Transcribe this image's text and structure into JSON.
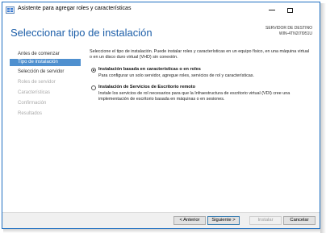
{
  "window": {
    "title": "Asistente para agregar roles y características"
  },
  "header": {
    "page_title": "Seleccionar tipo de instalación",
    "destination_label": "SERVIDOR DE DESTINO",
    "destination_name": "WIN-4TN2I7I951U"
  },
  "nav": {
    "items": [
      {
        "label": "Antes de comenzar",
        "state": "normal"
      },
      {
        "label": "Tipo de instalación",
        "state": "selected"
      },
      {
        "label": "Selección de servidor",
        "state": "normal"
      },
      {
        "label": "Roles de servidor",
        "state": "disabled"
      },
      {
        "label": "Características",
        "state": "disabled"
      },
      {
        "label": "Confirmación",
        "state": "disabled"
      },
      {
        "label": "Resultados",
        "state": "disabled"
      }
    ]
  },
  "main": {
    "intro": "Seleccione el tipo de instalación. Puede instalar roles y características en un equipo físico, en una máquina virtual o en un disco duro virtual (VHD) sin conexión.",
    "options": [
      {
        "label": "Instalación basada en características o en roles",
        "description": "Para configurar un solo servidor, agregue roles, servicios de rol y características.",
        "selected": true
      },
      {
        "label": "Instalación de Servicios de Escritorio remoto",
        "description": "Instale los servicios de rol necesarios para que la Infraestructura de escritorio virtual (VDI) cree una implementación de escritorio basada en máquinas o en sesiones.",
        "selected": false
      }
    ]
  },
  "footer": {
    "previous": "< Anterior",
    "next": "Siguiente >",
    "install": "Instalar",
    "cancel": "Cancelar"
  },
  "colors": {
    "accent": "#1c5ea8",
    "selected_nav": "#4f90cf",
    "window_border": "#1f6fc1"
  },
  "icons": [
    "app-icon",
    "minimize-icon",
    "maximize-icon"
  ]
}
